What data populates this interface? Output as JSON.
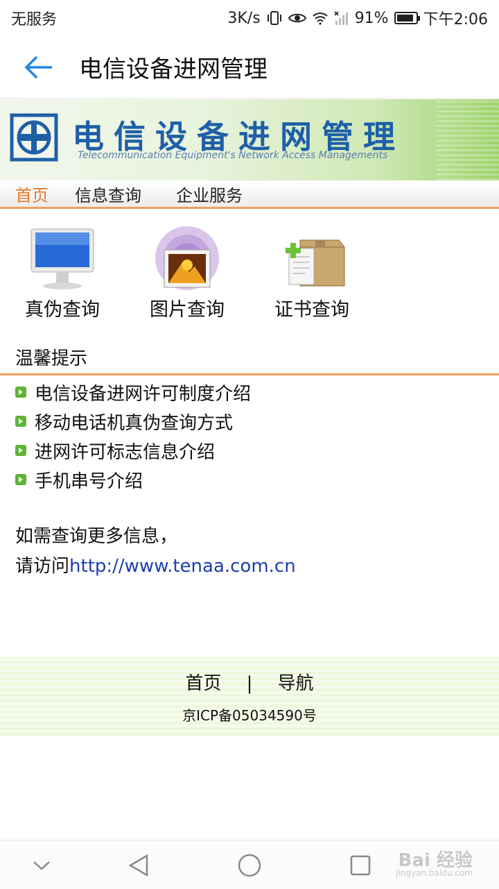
{
  "status": {
    "carrier": "无服务",
    "speed": "3K/s",
    "battery": "91%",
    "battery_level": 0.91,
    "time": "下午2:06"
  },
  "app_bar": {
    "title": "电信设备进网管理"
  },
  "banner": {
    "title": "电信设备进网管理",
    "subtitle": "Telecommunication Equipment's Network Access Managements"
  },
  "nav_tabs": [
    {
      "label": "首页"
    },
    {
      "label": "信息查询"
    },
    {
      "label": "企业服务"
    }
  ],
  "functions": [
    {
      "label": "真伪查询",
      "icon": "monitor-icon"
    },
    {
      "label": "图片查询",
      "icon": "picture-icon"
    },
    {
      "label": "证书查询",
      "icon": "box-add-icon"
    }
  ],
  "tips": {
    "title": "温馨提示",
    "items": [
      "电信设备进网许可制度介绍",
      "移动电话机真伪查询方式",
      "进网许可标志信息介绍",
      "手机串号介绍"
    ]
  },
  "more_info": {
    "line1": "如需查询更多信息，",
    "line2_prefix": "请访问",
    "link": "http://www.tenaa.com.cn"
  },
  "footer": {
    "home": "首页",
    "separator": "|",
    "nav": "导航",
    "icp": "京ICP备05034590号"
  },
  "watermark": {
    "text": "Bai 经验",
    "sub": "jingyan.baidu.com"
  },
  "colors": {
    "accent": "#e07a2a",
    "link": "#1a3fb0",
    "banner_text": "#1e5fa8",
    "bullet": "#5fb336"
  }
}
